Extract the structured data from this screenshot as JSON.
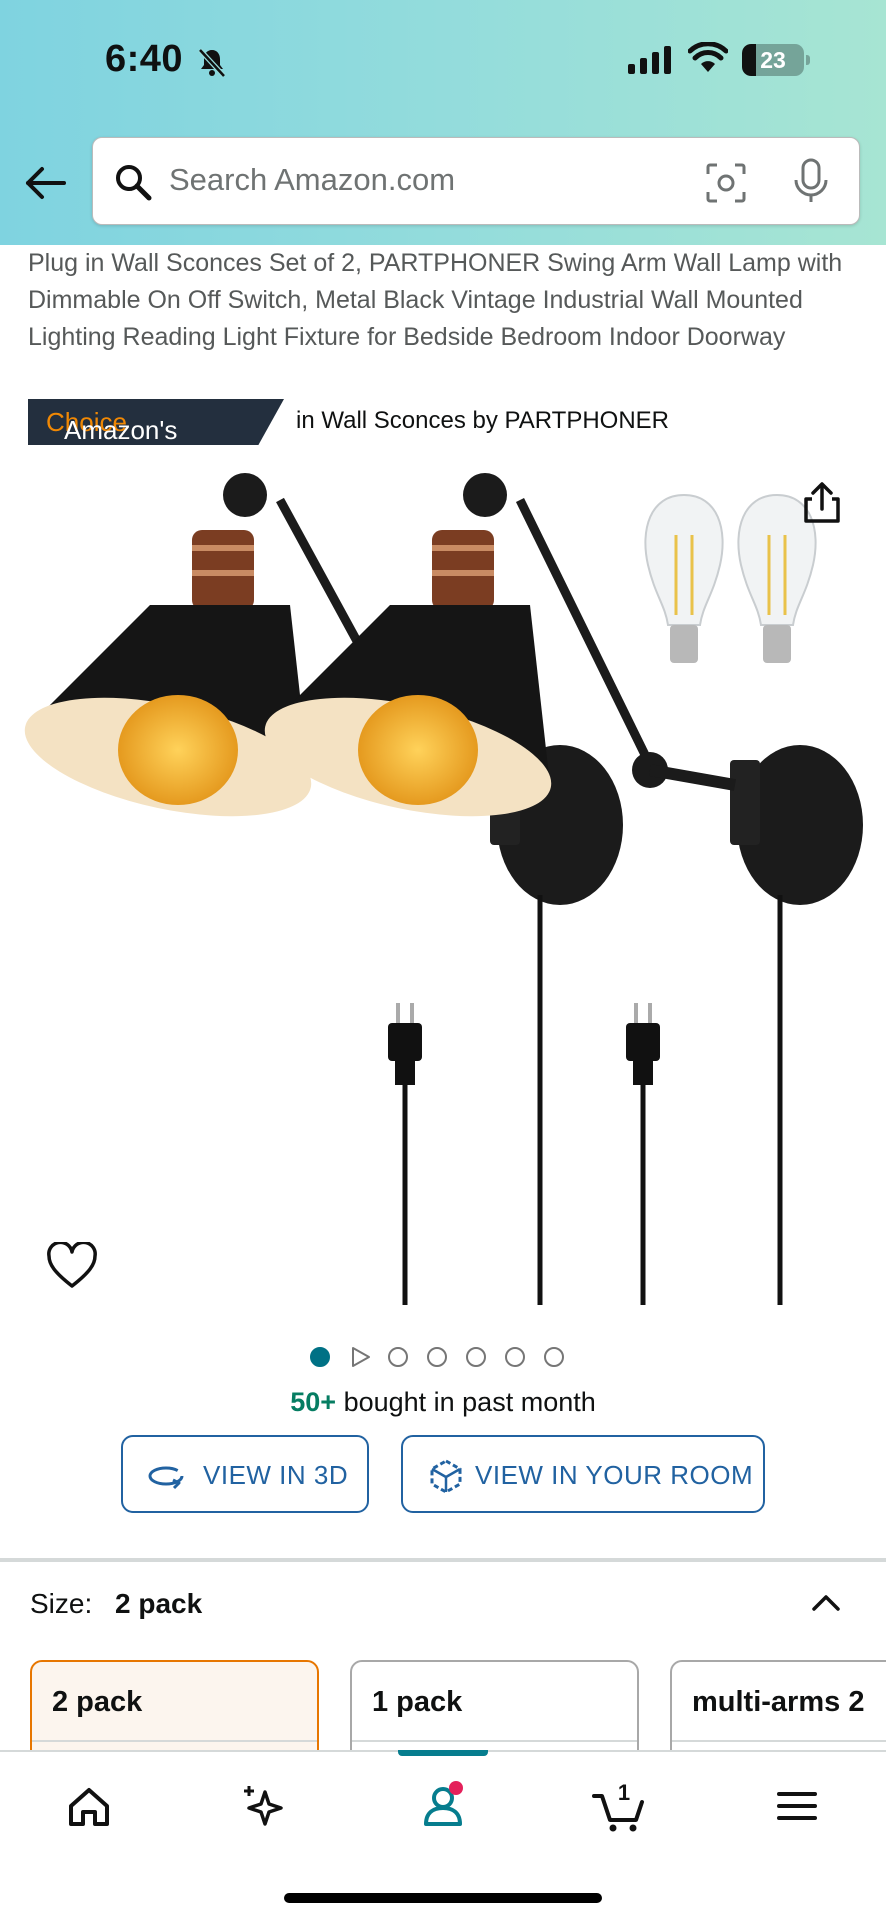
{
  "status_bar": {
    "time": "6:40",
    "battery": "23",
    "battery_level": 0.23
  },
  "search": {
    "placeholder": "Search Amazon.com"
  },
  "product": {
    "title": "Plug in Wall Sconces Set of 2, PARTPHONER Swing Arm Wall Lamp with Dimmable On Off Switch, Metal Black Vintage Industrial Wall Mounted Lighting Reading Light Fixture for Bedside Bedroom Indoor Doorway",
    "badge_prefix": "Amazon's",
    "badge_choice": "Choice",
    "badge_category": "in Wall Sconces by PARTPHONER",
    "image_count": 7,
    "active_image": 1,
    "bought_count": "50+",
    "bought_text": " bought in past month"
  },
  "buttons": {
    "view_3d": "VIEW IN 3D",
    "view_room": "VIEW IN YOUR ROOM"
  },
  "size": {
    "label": "Size:",
    "selected": "2 pack",
    "options": [
      "2 pack",
      "1 pack",
      "multi-arms 2"
    ]
  },
  "tabbar": {
    "items": [
      "home-icon",
      "sparkle-icon",
      "account-icon",
      "cart-icon",
      "menu-icon"
    ],
    "cart_count": "1",
    "active": "account-icon",
    "accent": "#067d8e",
    "notify_color": "#e4215b"
  },
  "colors": {
    "link_blue": "#2162a1",
    "badge_bg": "#232f3e",
    "badge_orange": "#f08804",
    "selected_border": "#e77600",
    "bought_green": "#067d62"
  }
}
